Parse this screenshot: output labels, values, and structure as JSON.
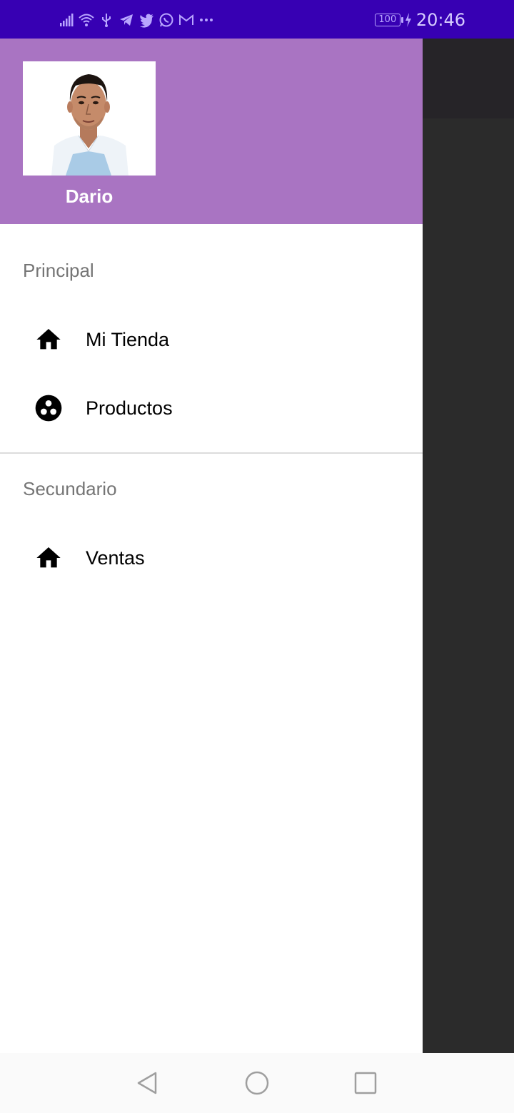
{
  "status_bar": {
    "time": "20:46",
    "battery": "100",
    "icons": [
      "signal-icon",
      "wifi-icon",
      "usb-icon",
      "telegram-icon",
      "twitter-icon",
      "whatsapp-icon",
      "gmail-icon",
      "more-dots-icon",
      "charging-bolt-icon"
    ],
    "colors": {
      "background": "#3700b3",
      "foreground": "#b9a6ff"
    }
  },
  "drawer": {
    "header": {
      "user_name": "Dario",
      "background_color": "#a974c2"
    },
    "sections": [
      {
        "title": "Principal",
        "items": [
          {
            "label": "Mi Tienda",
            "icon": "home-icon"
          },
          {
            "label": "Productos",
            "icon": "circle-dots-icon"
          }
        ]
      },
      {
        "title": "Secundario",
        "items": [
          {
            "label": "Ventas",
            "icon": "home-icon"
          }
        ]
      }
    ]
  },
  "nav_bar": {
    "buttons": [
      "back-icon",
      "home-circle-icon",
      "recents-square-icon"
    ]
  }
}
